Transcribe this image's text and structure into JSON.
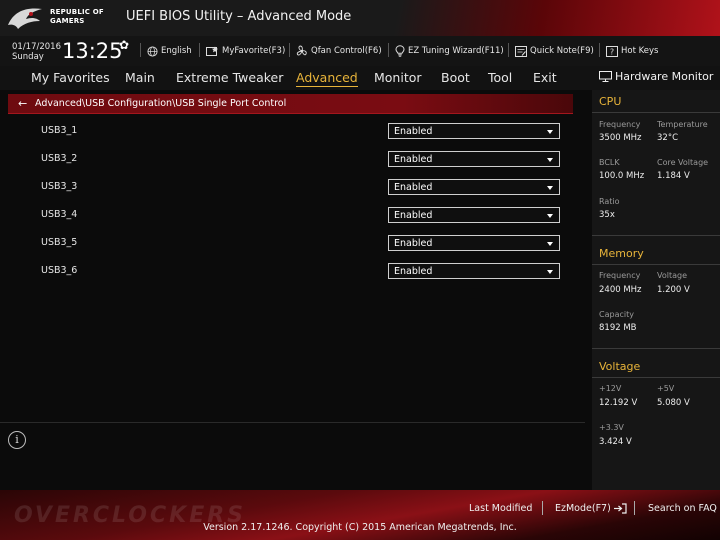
{
  "header": {
    "brand_line1": "REPUBLIC OF",
    "brand_line2": "GAMERS",
    "title": "UEFI BIOS Utility – Advanced Mode"
  },
  "infobar": {
    "date": "01/17/2016",
    "day": "Sunday",
    "time": "13:25",
    "items": [
      {
        "label": "English",
        "icon": "globe-icon"
      },
      {
        "label": "MyFavorite(F3)",
        "icon": "favorite-icon"
      },
      {
        "label": "Qfan Control(F6)",
        "icon": "fan-icon"
      },
      {
        "label": "EZ Tuning Wizard(F11)",
        "icon": "lightbulb-icon"
      },
      {
        "label": "Quick Note(F9)",
        "icon": "note-icon"
      },
      {
        "label": "Hot Keys",
        "icon": "help-icon"
      }
    ]
  },
  "nav": {
    "tabs": [
      "My Favorites",
      "Main",
      "Extreme Tweaker",
      "Advanced",
      "Monitor",
      "Boot",
      "Tool",
      "Exit"
    ],
    "active": "Advanced",
    "hw_title": "Hardware Monitor"
  },
  "breadcrumb": "Advanced\\USB Configuration\\USB Single Port Control",
  "settings": [
    {
      "label": "USB3_1",
      "value": "Enabled"
    },
    {
      "label": "USB3_2",
      "value": "Enabled"
    },
    {
      "label": "USB3_3",
      "value": "Enabled"
    },
    {
      "label": "USB3_4",
      "value": "Enabled"
    },
    {
      "label": "USB3_5",
      "value": "Enabled"
    },
    {
      "label": "USB3_6",
      "value": "Enabled"
    }
  ],
  "hw": {
    "cpu": {
      "title": "CPU",
      "frequency_label": "Frequency",
      "frequency": "3500 MHz",
      "temperature_label": "Temperature",
      "temperature": "32°C",
      "bclk_label": "BCLK",
      "bclk": "100.0 MHz",
      "core_voltage_label": "Core Voltage",
      "core_voltage": "1.184 V",
      "ratio_label": "Ratio",
      "ratio": "35x"
    },
    "memory": {
      "title": "Memory",
      "frequency_label": "Frequency",
      "frequency": "2400 MHz",
      "voltage_label": "Voltage",
      "voltage": "1.200 V",
      "capacity_label": "Capacity",
      "capacity": "8192 MB"
    },
    "voltage": {
      "title": "Voltage",
      "v12_label": "+12V",
      "v12": "12.192 V",
      "v5_label": "+5V",
      "v5": "5.080 V",
      "v33_label": "+3.3V",
      "v33": "3.424 V"
    }
  },
  "footer": {
    "last_modified": "Last Modified",
    "ezmode": "EzMode(F7)",
    "search": "Search on FAQ",
    "copyright": "Version 2.17.1246. Copyright (C) 2015 American Megatrends, Inc.",
    "watermark": "OVERCLOCKERS"
  },
  "colors": {
    "accent": "#e8b43a",
    "header_red": "#b0121a",
    "breadcrumb_red": "#7a0c12"
  }
}
